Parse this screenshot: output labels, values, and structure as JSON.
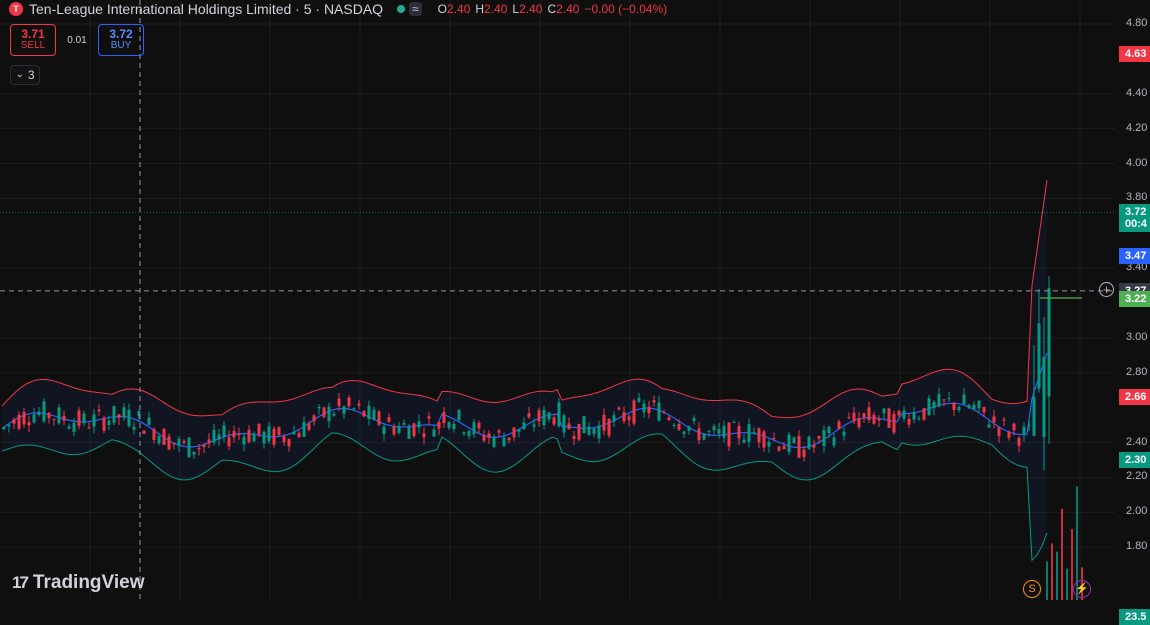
{
  "header": {
    "title": "Ten-League International Holdings Limited · 5 · NASDAQ",
    "logo_glyph": "T",
    "wave_glyph": "≈",
    "ohlc": [
      {
        "k": "O",
        "v": "2.40"
      },
      {
        "k": "H",
        "v": "2.40"
      },
      {
        "k": "L",
        "v": "2.40"
      },
      {
        "k": "C",
        "v": "2.40"
      }
    ],
    "change": "−0.00 (−0.04%)"
  },
  "trade": {
    "sell_price": "3.71",
    "sell_label": "SELL",
    "spread": "0.01",
    "buy_price": "3.72",
    "buy_label": "BUY"
  },
  "indicators_toggle": {
    "chevron": "⌄",
    "count": "3"
  },
  "brand": {
    "mark": "17",
    "name": "TradingView"
  },
  "price_axis": {
    "ticks": [
      "4.80",
      "4.40",
      "4.20",
      "4.00",
      "3.80",
      "3.40",
      "3.00",
      "2.80",
      "2.40",
      "2.20",
      "2.00",
      "1.80"
    ],
    "tick_values": [
      4.8,
      4.4,
      4.2,
      4.0,
      3.8,
      3.4,
      3.0,
      2.8,
      2.4,
      2.2,
      2.0,
      1.8
    ],
    "tags": [
      {
        "label": "4.63",
        "value": 4.63,
        "color": "#f23645"
      },
      {
        "label": "3.72",
        "value": 3.72,
        "color": "#089981"
      },
      {
        "label": "00:4",
        "value": 3.655,
        "color": "#089981"
      },
      {
        "label": "3.47",
        "value": 3.47,
        "color": "#2962ff"
      },
      {
        "label": "3.27",
        "value": 3.27,
        "color": "#363a45"
      },
      {
        "label": "3.22",
        "value": 3.225,
        "color": "#4caf50"
      },
      {
        "label": "2.66",
        "value": 2.66,
        "color": "#f23645"
      },
      {
        "label": "2.30",
        "value": 2.3,
        "color": "#089981"
      },
      {
        "label": "23.5",
        "value": 1.4,
        "color": "#089981"
      }
    ]
  },
  "crosshair_price": "3.27",
  "events": [
    {
      "glyph": "S",
      "color": "#f7931a"
    },
    {
      "glyph": "⚡",
      "color": "#9c27b0"
    }
  ],
  "colors": {
    "up": "#089981",
    "down": "#f23645",
    "basis": "#2962ff",
    "bb_upper": "#f23645",
    "bb_lower": "#089981",
    "stop": "#4caf50"
  }
}
